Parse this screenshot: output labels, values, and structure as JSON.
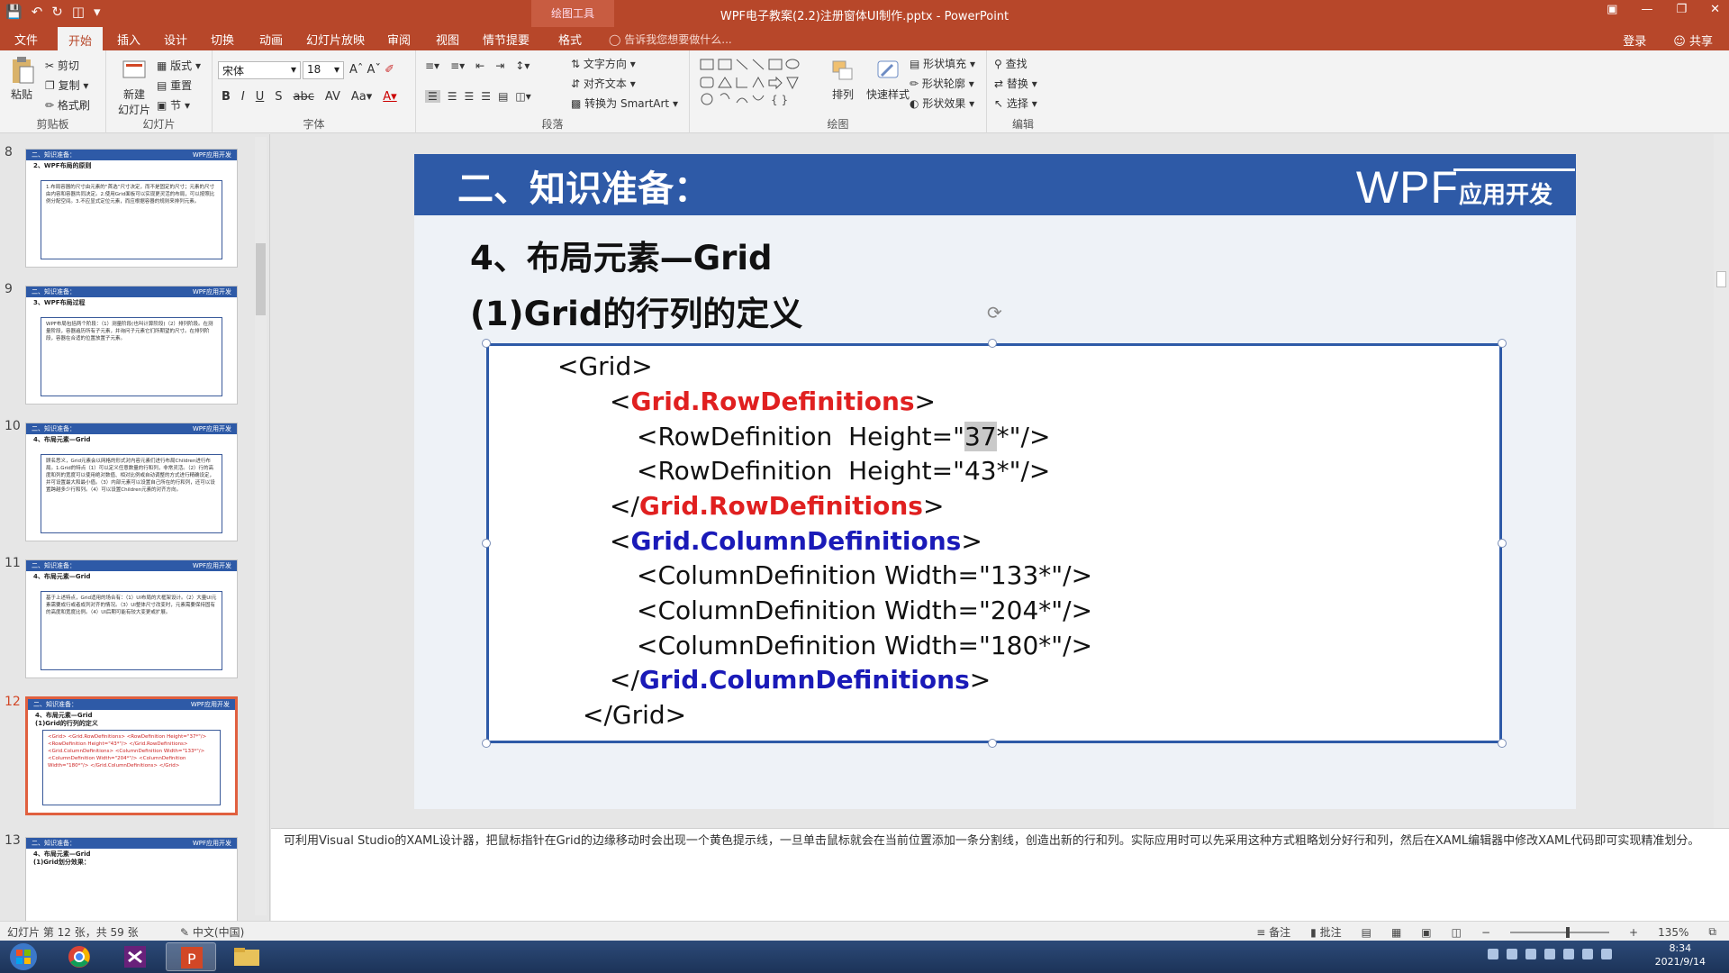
{
  "titlebar": {
    "title": "WPF电子教案(2.2)注册窗体UI制作.pptx - PowerPoint",
    "context_tab": "绘图工具"
  },
  "tabs": {
    "items": [
      "文件",
      "开始",
      "插入",
      "设计",
      "切换",
      "动画",
      "幻灯片放映",
      "审阅",
      "视图",
      "情节提要",
      "格式"
    ],
    "active": "开始",
    "tell_me": "告诉我您想要做什么...",
    "login": "登录",
    "share": "共享"
  },
  "ribbon": {
    "clipboard": {
      "paste": "粘贴",
      "cut": "剪切",
      "copy": "复制",
      "format_painter": "格式刷",
      "label": "剪贴板"
    },
    "slides": {
      "new_slide_1": "新建",
      "new_slide_2": "幻灯片",
      "layout": "版式",
      "reset": "重置",
      "section": "节",
      "label": "幻灯片"
    },
    "font": {
      "name": "宋体",
      "size": "18",
      "label": "字体"
    },
    "paragraph": {
      "text_direction": "文字方向",
      "align_text": "对齐文本",
      "smartart": "转换为 SmartArt",
      "label": "段落"
    },
    "drawing": {
      "arrange": "排列",
      "quick_styles": "快速样式",
      "shape_fill": "形状填充",
      "shape_outline": "形状轮廓",
      "shape_effects": "形状效果",
      "label": "绘图"
    },
    "editing": {
      "find": "查找",
      "replace": "替换",
      "select": "选择",
      "label": "编辑"
    }
  },
  "thumbnails": [
    {
      "num": "8",
      "band_left": "二、知识准备：",
      "band_right": "WPF应用开发",
      "title": "2、WPF布局的原则",
      "body": "1.布局容器的尺寸由元素的“首选”尺寸决定，而不是固定的尺寸；元素的尺寸由内容和容器共同决定。2.使用Grid面板可以实现更灵活的布局，可以按照比例分配空间。3.不应显式定位元素，而应根据容器的规则来排列元素。"
    },
    {
      "num": "9",
      "band_left": "二、知识准备：",
      "band_right": "WPF应用开发",
      "title": "3、WPF布局过程",
      "body": "WPF布局包括两个阶段：（1）测量阶段(也叫计算阶段)（2）排列阶段。在测量阶段，容器遍历所有子元素，并询问子元素它们所期望的尺寸。在排列阶段，容器在合适的位置放置子元素。"
    },
    {
      "num": "10",
      "band_left": "二、知识准备：",
      "band_right": "WPF应用开发",
      "title": "4、布局元素—Grid",
      "body": "顾名思义，Grid元素会以网格的形式对内容元素们进行布局Children进行布局。1.Grid的特点（1）可以定义任意数量的行和列，非常灵活。（2）行的高度和列的宽度可以使用绝对数值、相对比例或自动调整的方式进行精确设定，并可设置最大和最小值。（3）内部元素可以设置自己所在的行和列，还可以设置跨越多少行和列。（4）可以设置Children元素的对齐方向。"
    },
    {
      "num": "11",
      "band_left": "二、知识准备：",
      "band_right": "WPF应用开发",
      "title": "4、布局元素—Grid",
      "body": "基于上述特点，Grid适用的场合有：（1）UI布局的大框架设计。（2）大量UI元素需要成行或者成列对齐的情况。（3）UI整体尺寸改变时，元素需要保持固有的高度和宽度比例。（4）UI后期可能有较大变更或扩展。"
    },
    {
      "num": "12",
      "band_left": "二、知识准备：",
      "band_right": "WPF应用开发",
      "title": "4、布局元素—Grid",
      "title2": "(1)Grid的行列的定义",
      "body": "<Grid> <Grid.RowDefinitions> <RowDefinition Height=\"37*\"/> <RowDefinition Height=\"43*\"/> </Grid.RowDefinitions> <Grid.ColumnDefinitions> <ColumnDefinition Width=\"133*\"/> <ColumnDefinition Width=\"204*\"/> <ColumnDefinition Width=\"180*\"/> </Grid.ColumnDefinitions> </Grid>"
    },
    {
      "num": "13",
      "band_left": "二、知识准备：",
      "band_right": "WPF应用开发",
      "title": "4、布局元素—Grid",
      "title2": "(1)Grid划分效果：",
      "body": ""
    }
  ],
  "slide": {
    "band_title": "二、知识准备：",
    "brand_big": "WPF",
    "brand_small": "应用开发",
    "heading1": "4、布局元素—Grid",
    "heading2": "(1)Grid的行列的定义",
    "code": {
      "l1": "<Grid>",
      "l2_open": "<",
      "l2_tag": "Grid.RowDefinitions",
      "l2_close": ">",
      "l3_pre": "<RowDefinition  Height=\"",
      "l3_hl": "37",
      "l3_post": "*\"/>",
      "l4": "<RowDefinition  Height=\"43*\"/>",
      "l5_open": "</",
      "l5_tag": "Grid.RowDefinitions",
      "l5_close": ">",
      "l6_open": "<",
      "l6_tag": "Grid.ColumnDefinitions",
      "l6_close": ">",
      "l7": "<ColumnDefinition Width=\"133*\"/>",
      "l8": "<ColumnDefinition Width=\"204*\"/>",
      "l9": "<ColumnDefinition Width=\"180*\"/>",
      "l10_open": "</",
      "l10_tag": "Grid.ColumnDefinitions",
      "l10_close": ">",
      "l11": "</Grid>"
    }
  },
  "notes": "可利用Visual Studio的XAML设计器，把鼠标指针在Grid的边缘移动时会出现一个黄色提示线，一旦单击鼠标就会在当前位置添加一条分割线，创造出新的行和列。实际应用时可以先采用这种方式粗略划分好行和列，然后在XAML编辑器中修改XAML代码即可实现精准划分。",
  "status": {
    "slide_info": "幻灯片 第 12 张，共 59 张",
    "language": "中文(中国)",
    "notes": "备注",
    "comments": "批注",
    "zoom": "135%"
  },
  "taskbar": {
    "time": "8:34",
    "date": "2021/9/14"
  },
  "colors": {
    "accent": "#b7472a",
    "slide_band": "#2e5aa7",
    "code_red": "#e02020",
    "code_blue": "#1a1ab8"
  }
}
